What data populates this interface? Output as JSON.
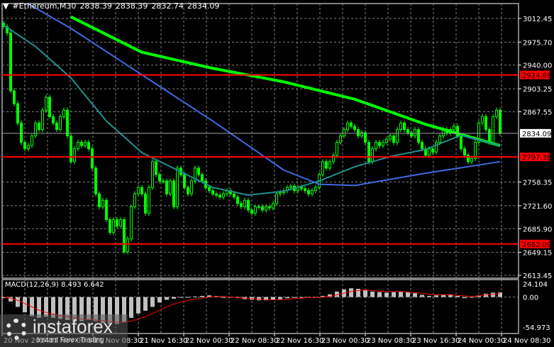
{
  "header": {
    "symbol": "#Ethereum,M30",
    "open": "2838.39",
    "high": "2838.39",
    "low": "2832.74",
    "close": "2834.09"
  },
  "macd_label": {
    "name": "MACD(12,26,9)",
    "main": "8.493",
    "signal": "6.642"
  },
  "watermark": {
    "brand": "instaforex",
    "tagline": "Instant Forex Trading"
  },
  "colors": {
    "bull": "#00ff00",
    "bear": "#00ff00",
    "ma_green": "#00ff00",
    "ma_blue": "#4169e1",
    "ma_teal": "#20908f",
    "level": "#ff0000",
    "macd_hist": "#c0c0c0",
    "macd_signal": "#ff0000",
    "grid": "#808080"
  },
  "chart_data": {
    "type": "candlestick",
    "timeframe": "M30",
    "ylim": [
      2613.45,
      3012.45
    ],
    "price_ticks": [
      "3012.45",
      "2975.70",
      "2940.00",
      "2903.25",
      "2867.55",
      "2758.35",
      "2721.60",
      "2685.90",
      "2649.15",
      "2613.45"
    ],
    "levels": [
      {
        "value": "2924.69"
      },
      {
        "value": "2797.38"
      },
      {
        "value": "2662.09"
      }
    ],
    "current_price": "2834.09",
    "time_labels": [
      "20 Nov 2024",
      "21 Nov 00:30",
      "21 Nov 08:30",
      "21 Nov 16:30",
      "22 Nov 00:30",
      "22 Nov 08:30",
      "22 Nov 16:30",
      "23 Nov 00:30",
      "23 Nov 08:30",
      "23 Nov 16:30",
      "24 Nov 00:30",
      "24 Nov 08:30"
    ],
    "closes": [
      3000,
      2990,
      2900,
      2880,
      2850,
      2820,
      2810,
      2815,
      2830,
      2850,
      2840,
      2870,
      2890,
      2860,
      2850,
      2840,
      2860,
      2870,
      2830,
      2790,
      2810,
      2820,
      2815,
      2820,
      2810,
      2780,
      2740,
      2720,
      2730,
      2700,
      2680,
      2700,
      2690,
      2700,
      2650,
      2670,
      2720,
      2740,
      2750,
      2740,
      2710,
      2750,
      2790,
      2770,
      2760,
      2760,
      2740,
      2760,
      2720,
      2780,
      2770,
      2750,
      2740,
      2760,
      2780,
      2770,
      2760,
      2750,
      2745,
      2740,
      2738,
      2735,
      2740,
      2745,
      2740,
      2735,
      2725,
      2720,
      2730,
      2715,
      2710,
      2720,
      2720,
      2715,
      2720,
      2718,
      2725,
      2740,
      2742,
      2745,
      2750,
      2752,
      2745,
      2750,
      2748,
      2745,
      2740,
      2745,
      2750,
      2770,
      2790,
      2780,
      2790,
      2800,
      2820,
      2830,
      2840,
      2850,
      2845,
      2840,
      2830,
      2835,
      2820,
      2790,
      2810,
      2820,
      2815,
      2820,
      2825,
      2830,
      2820,
      2840,
      2850,
      2840,
      2835,
      2830,
      2840,
      2820,
      2810,
      2800,
      2810,
      2805,
      2820,
      2830,
      2840,
      2835,
      2840,
      2845,
      2830,
      2810,
      2800,
      2790,
      2795,
      2820,
      2850,
      2860,
      2840,
      2820,
      2860,
      2870,
      2834.09
    ],
    "moving_averages": [
      {
        "color": "#00ff00",
        "points": [
          [
            19,
            3015
          ],
          [
            39,
            2960
          ],
          [
            59,
            2935
          ],
          [
            79,
            2914
          ],
          [
            99,
            2887
          ],
          [
            119,
            2848
          ],
          [
            140,
            2815
          ]
        ]
      },
      {
        "color": "#4169e1",
        "points": [
          [
            7,
            3035
          ],
          [
            19,
            2997
          ],
          [
            39,
            2925
          ],
          [
            59,
            2853
          ],
          [
            79,
            2777
          ],
          [
            89,
            2755
          ],
          [
            99,
            2753
          ],
          [
            119,
            2772
          ],
          [
            140,
            2790
          ]
        ]
      },
      {
        "color": "#20908f",
        "points": [
          [
            0,
            3002
          ],
          [
            9,
            2969
          ],
          [
            19,
            2920
          ],
          [
            29,
            2853
          ],
          [
            39,
            2804
          ],
          [
            49,
            2777
          ],
          [
            59,
            2750
          ],
          [
            69,
            2738
          ],
          [
            79,
            2744
          ],
          [
            89,
            2760
          ],
          [
            99,
            2782
          ],
          [
            109,
            2798
          ],
          [
            119,
            2809
          ],
          [
            129,
            2831
          ],
          [
            140,
            2815
          ]
        ]
      }
    ],
    "macd": {
      "ylim": [
        -54.973,
        24.104
      ],
      "ticks": [
        "24.104",
        "0.00",
        "-54.973"
      ],
      "histogram": [
        -2,
        -8,
        -18,
        -28,
        -35,
        -38,
        -36,
        -38,
        -40,
        -42,
        -45,
        -44,
        -42,
        -44,
        -48,
        -50,
        -49,
        -46,
        -38,
        -30,
        -25,
        -18,
        -10,
        -5,
        -3,
        -1,
        0,
        1,
        2,
        3,
        2,
        0,
        -1,
        -2,
        -4,
        -5,
        -6,
        -6,
        -5,
        -4,
        -2,
        -1,
        0,
        -1,
        0,
        2,
        5,
        10,
        14,
        16,
        15,
        13,
        10,
        9,
        8,
        9,
        10,
        9,
        7,
        4,
        2,
        3,
        4,
        5,
        2,
        -2,
        -1,
        3,
        6,
        8,
        8.493
      ],
      "signal": [
        0,
        -2,
        -6,
        -12,
        -18,
        -24,
        -28,
        -31,
        -34,
        -36,
        -38,
        -40,
        -41,
        -42,
        -43,
        -45,
        -46,
        -46,
        -44,
        -40,
        -36,
        -30,
        -24,
        -18,
        -13,
        -9,
        -6,
        -4,
        -2,
        0,
        1,
        1,
        0,
        -1,
        -2,
        -3,
        -4,
        -5,
        -5,
        -5,
        -4,
        -3,
        -2,
        -1,
        -1,
        0,
        1,
        4,
        7,
        10,
        12,
        13,
        12,
        11,
        10,
        10,
        10,
        9,
        8,
        7,
        5,
        4,
        4,
        4,
        3,
        2,
        1,
        2,
        4,
        5,
        6.642
      ]
    }
  }
}
